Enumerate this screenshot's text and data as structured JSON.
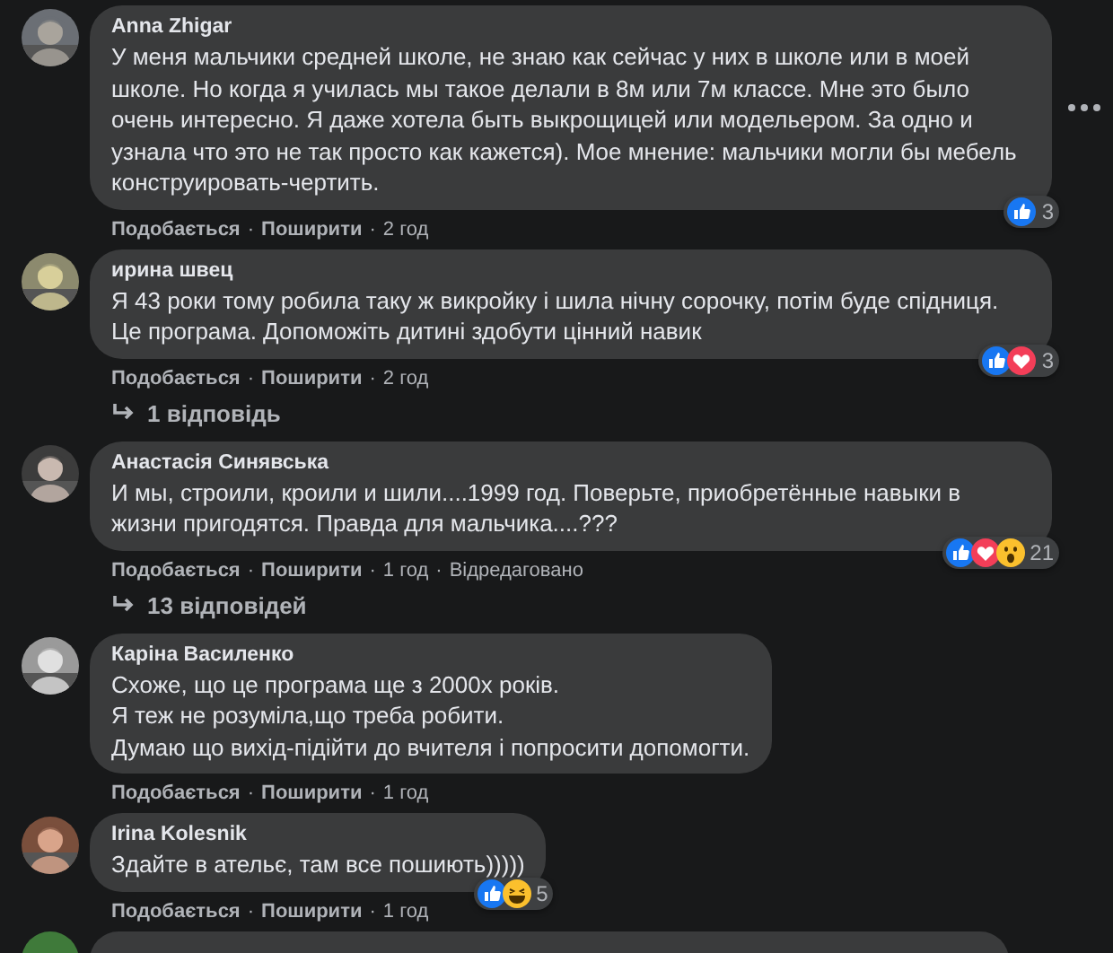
{
  "comments": [
    {
      "author": "Anna Zhigar",
      "lines": [
        "У меня мальчики средней школе, не знаю как сейчас у них в школе или в моей школе. Но когда я училась мы такое делали в 8м или 7м классе. Мне это было очень интересно. Я даже хотела быть выкрощицей или модельером. За одно и узнала что это не так просто как кажется). Мое мнение: мальчики могли бы мебель конструировать-чертить."
      ],
      "reactions": {
        "icons": [
          {
            "kind": "like"
          }
        ],
        "count": "3"
      },
      "like": "Подобається",
      "share": "Поширити",
      "time": "2 год",
      "options_button": true
    },
    {
      "author": "ирина швец",
      "lines": [
        "Я 43 роки тому робила таку ж викройку і шила нічну сорочку, потім буде спідниця. Це програма. Допоможіть дитині здобути цінний навик"
      ],
      "reactions": {
        "icons": [
          {
            "kind": "like"
          },
          {
            "kind": "love"
          }
        ],
        "count": "3"
      },
      "like": "Подобається",
      "share": "Поширити",
      "time": "2 год",
      "replies": "1 відповідь"
    },
    {
      "author": "Анастасія Синявська",
      "lines": [
        "И мы, строили, кроили и шили....1999 год. Поверьте, приобретённые навыки в жизни пригодятся. Правда для мальчика....???"
      ],
      "reactions": {
        "icons": [
          {
            "kind": "like"
          },
          {
            "kind": "love"
          },
          {
            "kind": "wow"
          }
        ],
        "count": "21"
      },
      "like": "Подобається",
      "share": "Поширити",
      "time": "1 год",
      "edited": "Відредаговано",
      "replies": "13 відповідей"
    },
    {
      "author": "Каріна Василенко",
      "lines": [
        "Схоже, що це програма ще з 2000х років.",
        "Я теж не розуміла,що треба робити.",
        "Думаю що вихід-підійти до вчителя і попросити допомогти."
      ],
      "like": "Подобається",
      "share": "Поширити",
      "time": "1 год"
    },
    {
      "author": "Irina Kolesnik",
      "lines": [
        "Здайте в ательє, там все пошиють)))))"
      ],
      "reactions": {
        "icons": [
          {
            "kind": "like"
          },
          {
            "kind": "haha"
          }
        ],
        "count": "5"
      },
      "like": "Подобається",
      "share": "Поширити",
      "time": "1 год"
    }
  ],
  "separator": "·",
  "more_below": true
}
